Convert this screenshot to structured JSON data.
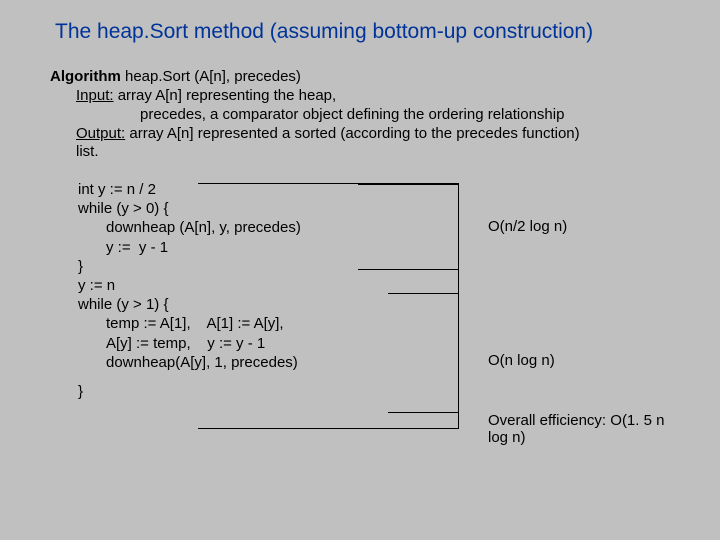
{
  "title": "The heap.Sort method (assuming bottom-up construction)",
  "algo": {
    "heading_bold": "Algorithm",
    "heading_rest": "  heap.Sort (A[n], precedes)",
    "input_label": "Input:",
    "input_text": " array A[n] representing the heap,",
    "input_cont": "precedes, a comparator object defining the ordering relationship",
    "output_label": "Output:",
    "output_text": " array A[n] represented a sorted (according to the precedes function)",
    "output_cont": "list."
  },
  "code": {
    "l1": "int y := n / 2",
    "l2": "while (y > 0) {",
    "l3": "downheap (A[n], y, precedes)",
    "l4": "y :=  y - 1",
    "l5": "}",
    "l6": "y := n",
    "l7": "while (y > 1) {",
    "l8": "temp := A[1],    A[1] := A[y],",
    "l9": "A[y] := temp,    y := y - 1",
    "l10": "downheap(A[y], 1, precedes)",
    "l11": "}"
  },
  "annotations": {
    "a1": "O(n/2 log n)",
    "a2": "O(n log n)",
    "a3": "Overall efficiency:  O(1. 5 n log n)"
  }
}
